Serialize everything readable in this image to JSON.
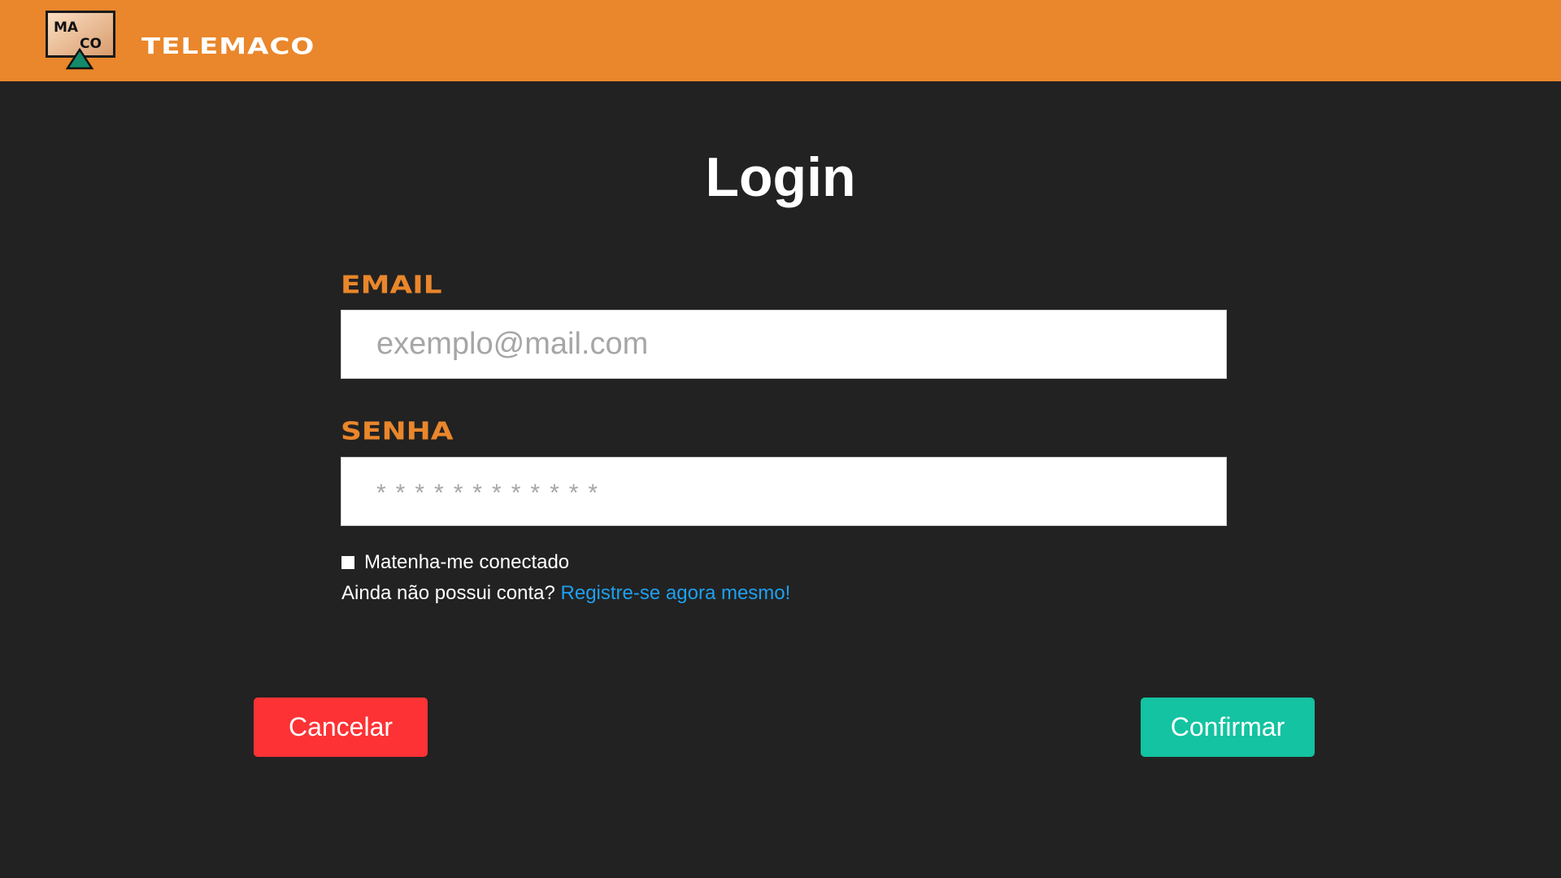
{
  "header": {
    "brand": "TELEMACO",
    "logo_text_top": "MA",
    "logo_text_bottom": "CO"
  },
  "page": {
    "title": "Login"
  },
  "form": {
    "email_label": "EMAIL",
    "email_placeholder": "exemplo@mail.com",
    "email_value": "",
    "password_label": "SENHA",
    "password_placeholder": "************",
    "password_value": "",
    "remember_label": "Matenha-me conectado",
    "remember_checked": false,
    "register_prompt": "Ainda não possui conta? ",
    "register_link": "Registre-se agora mesmo!"
  },
  "actions": {
    "cancel_label": "Cancelar",
    "confirm_label": "Confirmar"
  },
  "colors": {
    "header_bg": "#ea862b",
    "page_bg": "#222222",
    "label_accent": "#ea862b",
    "link": "#1ea0f0",
    "cancel_bg": "#fc3235",
    "confirm_bg": "#13c3a1"
  }
}
